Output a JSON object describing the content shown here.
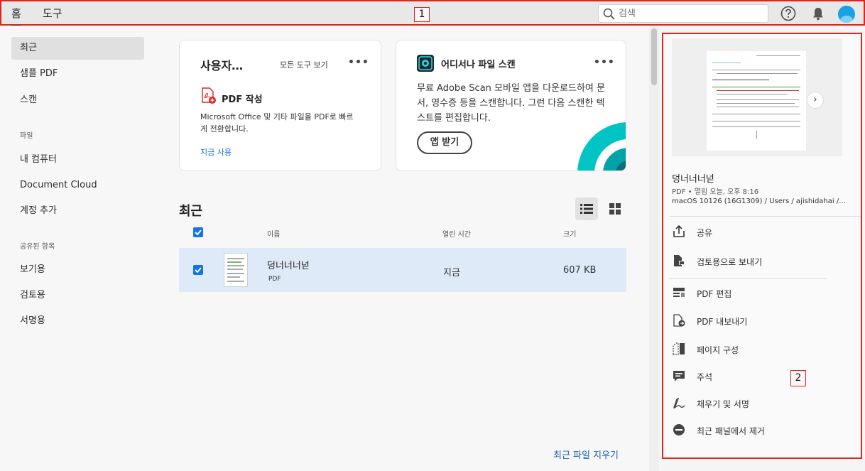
{
  "topbar": {
    "tabs": [
      {
        "label": "홈"
      },
      {
        "label": "도구"
      }
    ],
    "marker_1": "1",
    "search_placeholder": "검색"
  },
  "sidebar": {
    "items": [
      {
        "label": "최근"
      },
      {
        "label": "샘플 PDF"
      },
      {
        "label": "스캔"
      }
    ],
    "files_header": "파일",
    "files_items": [
      {
        "label": "내 컴퓨터"
      },
      {
        "label": "Document Cloud"
      },
      {
        "label": "계정 추가"
      }
    ],
    "shared_header": "공유된 항목",
    "shared_items": [
      {
        "label": "보기용"
      },
      {
        "label": "검토용"
      },
      {
        "label": "서명용"
      }
    ]
  },
  "cards": {
    "tools": {
      "title": "사용자…",
      "view_all": "모든 도구 보기",
      "more": "•••",
      "tool_name": "PDF 작성",
      "tool_desc": "Microsoft Office 및 기타 파일을 PDF로 빠르게 전환합니다.",
      "use_now": "지금 사용"
    },
    "scan": {
      "title": "어디서나 파일 스캔",
      "more": "•••",
      "desc": "무료 Adobe Scan 모바일 앱을 다운로드하여 문서, 영수증 등을 스캔합니다. 그런 다음 스캔한 텍스트를 편집합니다.",
      "button": "앱 받기"
    }
  },
  "recent": {
    "title": "최근",
    "columns": {
      "name": "이름",
      "opened": "열린 시간",
      "size": "크기"
    },
    "rows": [
      {
        "name": "덩너너너넏",
        "type": "PDF",
        "opened": "지금",
        "size": "607 KB"
      }
    ],
    "clear": "최근 파일 지우기"
  },
  "panel": {
    "file_name": "덩너너너넏",
    "meta": "PDF  •  열림 오늘, 오후 8:16",
    "path": "macOS 10126 (16G1309) / Users / ajishidahai /...",
    "next": "›",
    "actions": [
      {
        "label": "공유"
      },
      {
        "label": "검토용으로 보내기"
      },
      {
        "label": "PDF 편집"
      },
      {
        "label": "PDF 내보내기"
      },
      {
        "label": "페이지 구성"
      },
      {
        "label": "주석"
      },
      {
        "label": "채우기 및 서명"
      },
      {
        "label": "최근 패널에서 제거"
      }
    ],
    "marker_2": "2"
  },
  "colors": {
    "accent": "#1473e6",
    "annotation": "#e0241b",
    "selected_row": "#dfeaf8",
    "scan_teal": "#00c4c4"
  }
}
